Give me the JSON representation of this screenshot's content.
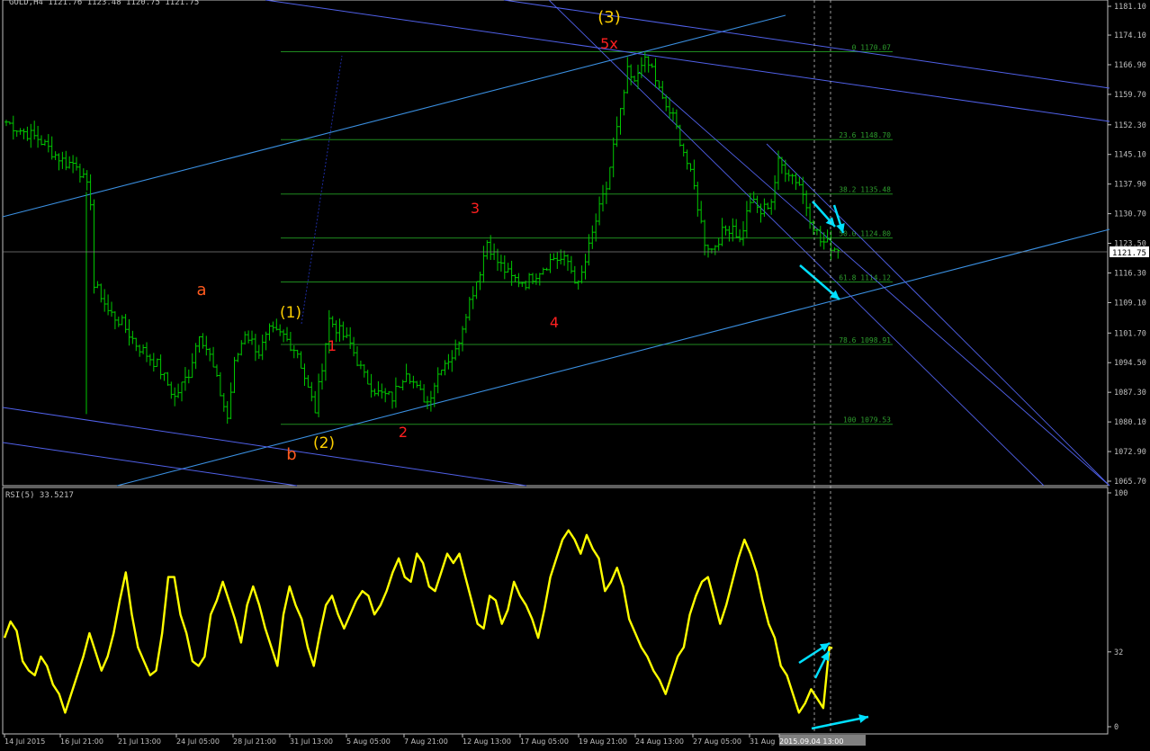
{
  "window": {
    "symbol_header": "GOLD,H4  1121.76 1123.48 1120.75 1121.75",
    "colors": {
      "background": "#000000",
      "frame": "#c0c0c0",
      "candles": "#00c800",
      "channel": "#3a8fe0",
      "channel_thin": "#5060e8",
      "fib": "#1f8a1f",
      "fib_label": "#2e9e2e",
      "wave_red": "#ff2020",
      "wave_orange": "#ff5a1e",
      "wave_yellow": "#ffd000",
      "rsi_line": "#ffff00",
      "arrows": "#00e0ff",
      "price_label_bg": "#ffffff"
    }
  },
  "chart_data": [
    {
      "type": "candlestick",
      "title": "GOLD,H4",
      "header_values": {
        "open": 1121.76,
        "high": 1123.48,
        "low": 1120.75,
        "close": 1121.75
      },
      "ylim": [
        1063.5,
        1185.0
      ],
      "y_ticks": [
        "1181.10",
        "1174.10",
        "1166.90",
        "1159.70",
        "1152.30",
        "1145.10",
        "1137.90",
        "1130.70",
        "1123.50",
        "1116.30",
        "1109.10",
        "1101.70",
        "1094.50",
        "1087.30",
        "1080.10",
        "1072.90",
        "1065.70"
      ],
      "current_price_label": "1121.75",
      "current_price": 1121.75,
      "x_ticks": [
        "14 Jul 2015",
        "16 Jul 21:00",
        "21 Jul 13:00",
        "24 Jul 05:00",
        "28 Jul 21:00",
        "31 Jul 13:00",
        "5 Aug 05:00",
        "7 Aug 21:00",
        "12 Aug 13:00",
        "17 Aug 05:00",
        "19 Aug 21:00",
        "24 Aug 13:00",
        "27 Aug 05:00",
        "31 Aug",
        "2015.09.04 13:00"
      ],
      "fib_levels": [
        {
          "label": "0 1170.07",
          "price": 1170.07
        },
        {
          "label": "23.6 1148.70",
          "price": 1148.7
        },
        {
          "label": "38.2 1135.48",
          "price": 1135.48
        },
        {
          "label": "50.0 1124.80",
          "price": 1124.8
        },
        {
          "label": "61.8 1114.12",
          "price": 1114.12
        },
        {
          "label": "78.6 1098.91",
          "price": 1098.91
        },
        {
          "label": "100 1079.53",
          "price": 1079.53
        }
      ],
      "wave_labels": [
        {
          "text": "(3)",
          "color": "yellow"
        },
        {
          "text": "5x",
          "color": "red"
        },
        {
          "text": "3",
          "color": "red"
        },
        {
          "text": "4",
          "color": "red"
        },
        {
          "text": "a",
          "color": "orange"
        },
        {
          "text": "(1)",
          "color": "yellow"
        },
        {
          "text": "1",
          "color": "red"
        },
        {
          "text": "2",
          "color": "red"
        },
        {
          "text": "(2)",
          "color": "yellow"
        },
        {
          "text": "b",
          "color": "orange"
        }
      ],
      "close_anchors": [
        [
          0,
          1153
        ],
        [
          4,
          1151
        ],
        [
          9,
          1149
        ],
        [
          14,
          1145
        ],
        [
          17,
          1143
        ],
        [
          20,
          1143
        ],
        [
          23,
          1137
        ],
        [
          24,
          1134
        ],
        [
          25,
          1113
        ],
        [
          27,
          1111
        ],
        [
          29,
          1107
        ],
        [
          33,
          1104
        ],
        [
          37,
          1099
        ],
        [
          43,
          1094
        ],
        [
          48,
          1086
        ],
        [
          52,
          1092
        ],
        [
          55,
          1102
        ],
        [
          58,
          1096
        ],
        [
          61,
          1087
        ],
        [
          63,
          1081
        ],
        [
          65,
          1094
        ],
        [
          68,
          1102
        ],
        [
          72,
          1097
        ],
        [
          75,
          1102
        ],
        [
          79,
          1101
        ],
        [
          83,
          1097
        ],
        [
          86,
          1088
        ],
        [
          88,
          1083
        ],
        [
          92,
          1105
        ],
        [
          94,
          1103
        ],
        [
          98,
          1099
        ],
        [
          102,
          1091
        ],
        [
          106,
          1087
        ],
        [
          110,
          1086
        ],
        [
          114,
          1093
        ],
        [
          117,
          1088
        ],
        [
          120,
          1085
        ],
        [
          124,
          1094
        ],
        [
          128,
          1097
        ],
        [
          131,
          1107
        ],
        [
          135,
          1117
        ],
        [
          137,
          1124
        ],
        [
          140,
          1119
        ],
        [
          144,
          1115
        ],
        [
          148,
          1114
        ],
        [
          152,
          1117
        ],
        [
          156,
          1120
        ],
        [
          160,
          1119
        ],
        [
          163,
          1113
        ],
        [
          165,
          1119
        ],
        [
          168,
          1129
        ],
        [
          171,
          1137
        ],
        [
          173,
          1147
        ],
        [
          175,
          1155
        ],
        [
          177,
          1165
        ],
        [
          179,
          1162
        ],
        [
          181,
          1168
        ],
        [
          184,
          1166
        ],
        [
          187,
          1158
        ],
        [
          190,
          1154
        ],
        [
          193,
          1146
        ],
        [
          196,
          1137
        ],
        [
          199,
          1124
        ],
        [
          201,
          1122
        ],
        [
          204,
          1126
        ],
        [
          207,
          1128
        ],
        [
          209,
          1124
        ],
        [
          212,
          1134
        ],
        [
          215,
          1131
        ],
        [
          218,
          1134
        ],
        [
          220,
          1143
        ],
        [
          223,
          1141
        ],
        [
          226,
          1138
        ],
        [
          229,
          1130
        ],
        [
          232,
          1124
        ],
        [
          235,
          1123
        ],
        [
          237,
          1121.75
        ]
      ]
    },
    {
      "type": "line",
      "title": "RSI(5) 33.5217",
      "ylim": [
        0,
        100
      ],
      "y_ticks": [
        "100",
        "32",
        "0"
      ],
      "anchors": [
        [
          0,
          38
        ],
        [
          2,
          45
        ],
        [
          4,
          41
        ],
        [
          6,
          28
        ],
        [
          8,
          24
        ],
        [
          10,
          22
        ],
        [
          12,
          30
        ],
        [
          14,
          26
        ],
        [
          16,
          18
        ],
        [
          18,
          14
        ],
        [
          20,
          6
        ],
        [
          22,
          14
        ],
        [
          24,
          22
        ],
        [
          26,
          30
        ],
        [
          28,
          40
        ],
        [
          30,
          32
        ],
        [
          32,
          24
        ],
        [
          34,
          30
        ],
        [
          36,
          40
        ],
        [
          38,
          54
        ],
        [
          40,
          66
        ],
        [
          42,
          48
        ],
        [
          44,
          34
        ],
        [
          46,
          28
        ],
        [
          48,
          22
        ],
        [
          50,
          24
        ],
        [
          52,
          40
        ],
        [
          54,
          64
        ],
        [
          56,
          64
        ],
        [
          58,
          48
        ],
        [
          60,
          40
        ],
        [
          62,
          28
        ],
        [
          64,
          26
        ],
        [
          66,
          30
        ],
        [
          68,
          48
        ],
        [
          70,
          54
        ],
        [
          72,
          62
        ],
        [
          74,
          54
        ],
        [
          76,
          46
        ],
        [
          78,
          36
        ],
        [
          80,
          52
        ],
        [
          82,
          60
        ],
        [
          84,
          52
        ],
        [
          86,
          42
        ],
        [
          88,
          34
        ],
        [
          90,
          26
        ],
        [
          92,
          48
        ],
        [
          94,
          60
        ],
        [
          96,
          52
        ],
        [
          98,
          46
        ],
        [
          100,
          34
        ],
        [
          102,
          26
        ],
        [
          104,
          40
        ],
        [
          106,
          52
        ],
        [
          108,
          56
        ],
        [
          110,
          48
        ],
        [
          112,
          42
        ],
        [
          114,
          48
        ],
        [
          116,
          54
        ],
        [
          118,
          58
        ],
        [
          120,
          56
        ],
        [
          122,
          48
        ],
        [
          124,
          52
        ],
        [
          126,
          58
        ],
        [
          128,
          66
        ],
        [
          130,
          72
        ],
        [
          132,
          64
        ],
        [
          134,
          62
        ],
        [
          136,
          74
        ],
        [
          138,
          70
        ],
        [
          140,
          60
        ],
        [
          142,
          58
        ],
        [
          144,
          66
        ],
        [
          146,
          74
        ],
        [
          148,
          70
        ],
        [
          150,
          74
        ],
        [
          152,
          64
        ],
        [
          154,
          54
        ],
        [
          156,
          44
        ],
        [
          158,
          42
        ],
        [
          160,
          56
        ],
        [
          162,
          54
        ],
        [
          164,
          44
        ],
        [
          166,
          50
        ],
        [
          168,
          62
        ],
        [
          170,
          56
        ],
        [
          172,
          52
        ],
        [
          174,
          46
        ],
        [
          176,
          38
        ],
        [
          178,
          50
        ],
        [
          180,
          64
        ],
        [
          182,
          72
        ],
        [
          184,
          80
        ],
        [
          186,
          84
        ],
        [
          188,
          80
        ],
        [
          190,
          74
        ],
        [
          192,
          82
        ],
        [
          194,
          76
        ],
        [
          196,
          72
        ],
        [
          198,
          58
        ],
        [
          200,
          62
        ],
        [
          202,
          68
        ],
        [
          204,
          60
        ],
        [
          206,
          46
        ],
        [
          208,
          40
        ],
        [
          210,
          34
        ],
        [
          212,
          30
        ],
        [
          214,
          24
        ],
        [
          216,
          20
        ],
        [
          218,
          14
        ],
        [
          220,
          22
        ],
        [
          222,
          30
        ],
        [
          224,
          34
        ],
        [
          226,
          48
        ],
        [
          228,
          56
        ],
        [
          230,
          62
        ],
        [
          232,
          64
        ],
        [
          234,
          54
        ],
        [
          236,
          44
        ],
        [
          238,
          52
        ],
        [
          240,
          62
        ],
        [
          242,
          72
        ],
        [
          244,
          80
        ],
        [
          246,
          74
        ],
        [
          248,
          66
        ],
        [
          250,
          54
        ],
        [
          252,
          44
        ],
        [
          254,
          38
        ],
        [
          256,
          26
        ],
        [
          258,
          22
        ],
        [
          260,
          14
        ],
        [
          262,
          6
        ],
        [
          264,
          10
        ],
        [
          266,
          16
        ],
        [
          268,
          12
        ],
        [
          270,
          8
        ],
        [
          272,
          34
        ],
        [
          273,
          33.52
        ]
      ],
      "current_value": 33.5217
    }
  ]
}
